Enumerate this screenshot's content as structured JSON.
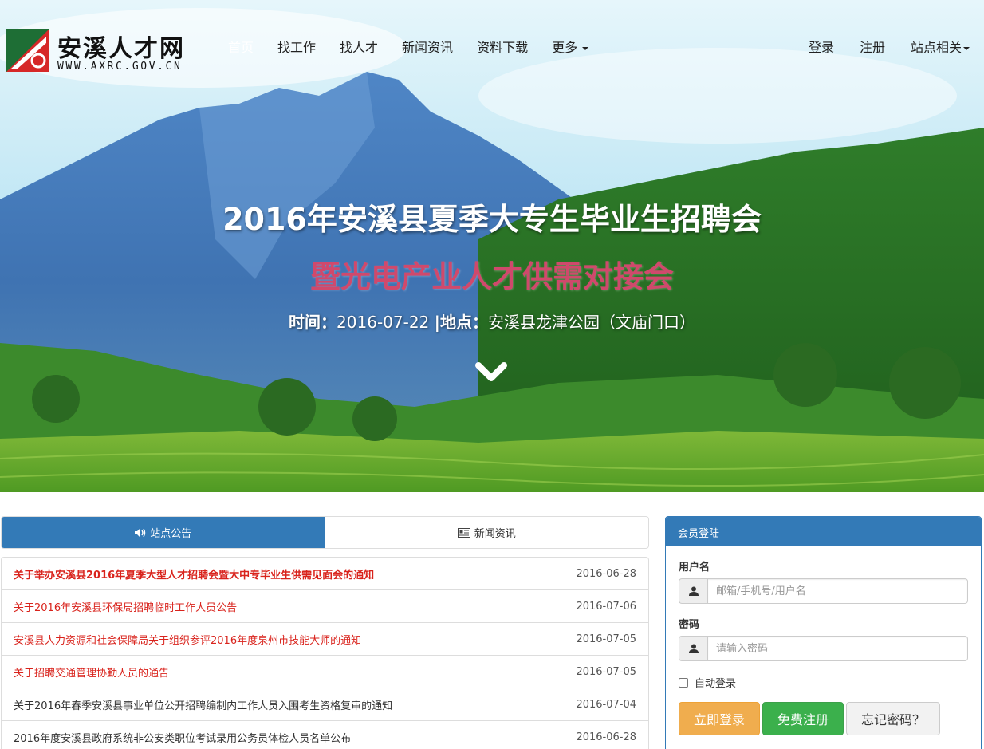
{
  "site": {
    "name": "安溪人才网",
    "url": "WWW.AXRC.GOV.CN"
  },
  "nav": {
    "items": [
      {
        "label": "首页",
        "active": true
      },
      {
        "label": "找工作"
      },
      {
        "label": "找人才"
      },
      {
        "label": "新闻资讯"
      },
      {
        "label": "资料下载"
      },
      {
        "label": "更多"
      }
    ],
    "right": [
      {
        "label": "登录"
      },
      {
        "label": "注册"
      },
      {
        "label": "站点相关"
      }
    ]
  },
  "hero": {
    "headline": "2016年安溪县夏季大专生毕业生招聘会",
    "subline": "暨光电产业人才供需对接会",
    "time_label": "时间：",
    "time_value": "2016-07-22",
    "place_label": "|地点：",
    "place_value": "安溪县龙津公园（文庙门口）"
  },
  "tabs": [
    {
      "label": "站点公告",
      "icon": "volume-icon",
      "active": true
    },
    {
      "label": "新闻资讯",
      "icon": "newspaper-icon"
    }
  ],
  "notices": [
    {
      "title": "关于举办安溪县2016年夏季大型人才招聘会暨大中专毕业生供需见面会的通知",
      "date": "2016-06-28",
      "style": "hot-top"
    },
    {
      "title": "关于2016年安溪县环保局招聘临时工作人员公告",
      "date": "2016-07-06",
      "style": "hot"
    },
    {
      "title": "安溪县人力资源和社会保障局关于组织参评2016年度泉州市技能大师的通知",
      "date": "2016-07-05",
      "style": "hot"
    },
    {
      "title": "关于招聘交通管理协勤人员的通告",
      "date": "2016-07-05",
      "style": "hot"
    },
    {
      "title": "关于2016年春季安溪县事业单位公开招聘编制内工作人员入围考生资格复审的通知",
      "date": "2016-07-04",
      "style": "normal"
    },
    {
      "title": "2016年度安溪县政府系统非公安类职位考试录用公务员体检人员名单公布",
      "date": "2016-06-28",
      "style": "normal"
    }
  ],
  "login": {
    "title": "会员登陆",
    "username_label": "用户名",
    "username_placeholder": "邮箱/手机号/用户名",
    "password_label": "密码",
    "password_placeholder": "请输入密码",
    "remember_label": "自动登录",
    "submit_label": "立即登录",
    "register_label": "免费注册",
    "forgot_label": "忘记密码？"
  },
  "colors": {
    "primary": "#337ab7",
    "warning": "#f0ad4e",
    "success": "#3bb04c",
    "hot": "#d9231c",
    "subline": "#d0496c"
  }
}
